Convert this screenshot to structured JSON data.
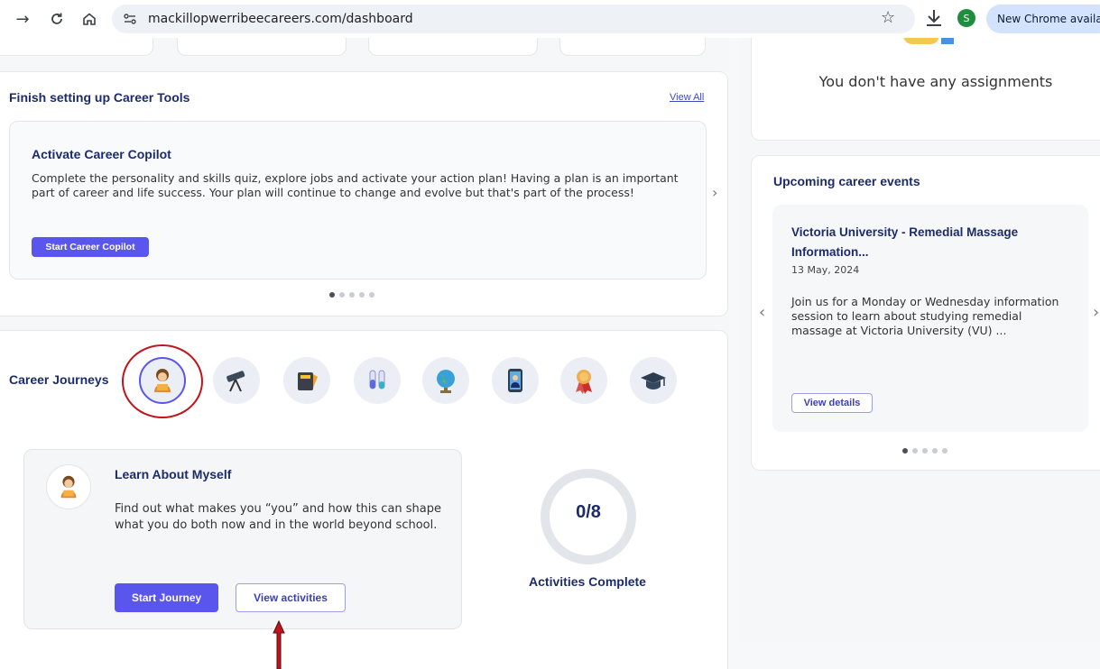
{
  "browser": {
    "url": "mackillopwerribeecareers.com/dashboard",
    "chrome_update": "New Chrome availabl",
    "profile_initial": "S"
  },
  "assignments": {
    "empty_text": "You don't have any assignments"
  },
  "career_tools": {
    "title": "Finish setting up Career Tools",
    "view_all": "View All",
    "card_title": "Activate Career Copilot",
    "card_desc": "Complete the personality and skills quiz, explore jobs and activate your action plan! Having a plan is an important part of career and life success. Your plan will continue to change and evolve but that's part of the process!",
    "button": "Start Career Copilot"
  },
  "events": {
    "title": "Upcoming career events",
    "event_title": "Victoria University - Remedial Massage Information...",
    "event_date": "13 May, 2024",
    "event_desc": "Join us for a Monday or Wednesday information session to learn about studying remedial massage at Victoria University (VU) ...",
    "button": "View details"
  },
  "journeys": {
    "title": "Career Journeys",
    "icons": [
      "student-reading-icon",
      "telescope-icon",
      "notebook-icon",
      "test-tubes-icon",
      "globe-icon",
      "phone-person-icon",
      "award-ribbon-icon",
      "graduation-cap-icon"
    ],
    "card_title": "Learn About Myself",
    "card_desc": "Find out what makes you “you” and how this can shape what you do both now and in the world beyond school.",
    "start_button": "Start Journey",
    "view_button": "View activities",
    "progress": "0/8",
    "progress_label": "Activities Complete",
    "completed": 0,
    "total": 8
  },
  "colors": {
    "brand_purple": "#5a55ec",
    "navy_text": "#1c2b6b",
    "highlight_red": "#c0141b"
  }
}
